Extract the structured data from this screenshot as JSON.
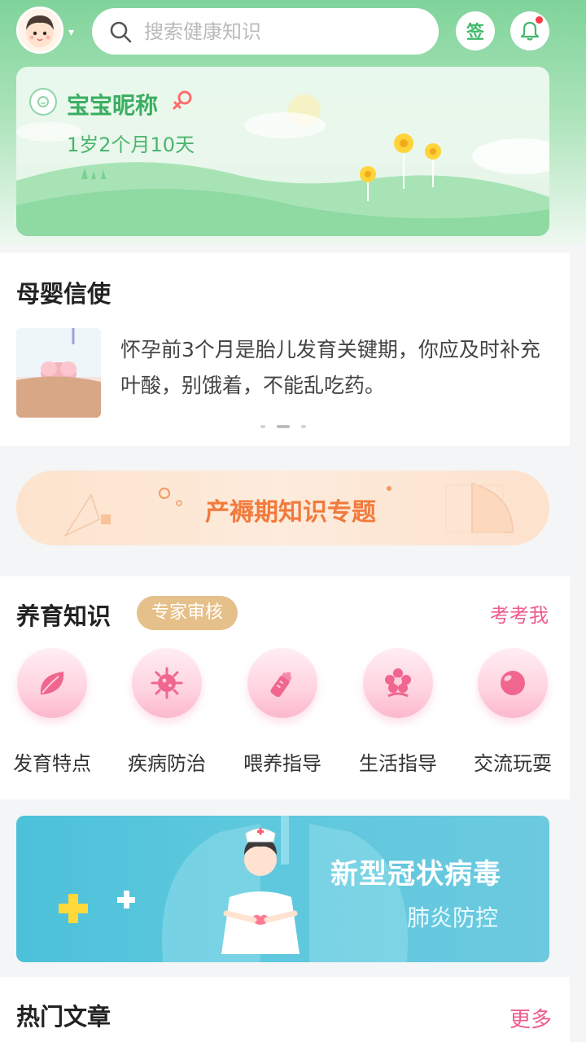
{
  "header": {
    "search_placeholder": "搜索健康知识",
    "sign_label": "签"
  },
  "baby": {
    "name": "宝宝昵称",
    "age": "1岁2个月10天"
  },
  "messenger": {
    "title": "母婴信使",
    "message": "怀孕前3个月是胎儿发育关键期，你应及时补充叶酸，别饿着，不能乱吃药。"
  },
  "topic": {
    "label": "产褥期知识专题"
  },
  "knowledge": {
    "title": "养育知识",
    "badge": "专家审核",
    "quiz_link": "考考我",
    "categories": [
      {
        "label": "发育特点",
        "icon": "leaf-icon"
      },
      {
        "label": "疾病防治",
        "icon": "virus-icon"
      },
      {
        "label": "喂养指导",
        "icon": "bottle-icon"
      },
      {
        "label": "生活指导",
        "icon": "flower-icon"
      },
      {
        "label": "交流玩耍",
        "icon": "ball-icon"
      }
    ]
  },
  "covid_banner": {
    "title": "新型冠状病毒",
    "subtitle": "肺炎防控"
  },
  "hot": {
    "title": "热门文章",
    "more": "更多"
  },
  "colors": {
    "brand_green": "#41b86c",
    "pink_accent": "#ef5c8c",
    "orange_topic": "#f27a3c",
    "badge_gold": "#e6c08a",
    "covid_blue": "#4cc1da"
  }
}
